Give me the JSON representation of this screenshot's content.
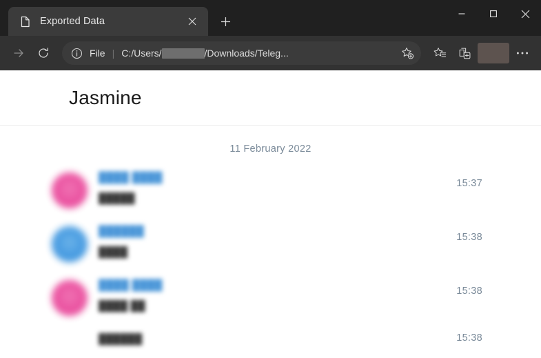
{
  "window": {
    "controls": {
      "minimize_label": "Minimize",
      "maximize_label": "Maximize",
      "close_label": "Close"
    }
  },
  "tabstrip": {
    "tabs": [
      {
        "title": "Exported Data",
        "favicon": "document-icon",
        "close_label": "Close tab",
        "active": true
      }
    ],
    "new_tab_label": "New tab"
  },
  "toolbar": {
    "back_label": "Back",
    "forward_label": "Forward",
    "refresh_label": "Refresh",
    "address": {
      "info_icon": "info-icon",
      "scheme_label": "File",
      "separator": "|",
      "url_prefix": "C:/Users/",
      "url_redacted": "redacted-username",
      "url_suffix": "/Downloads/Teleg...",
      "full_url": "C:/Users/████/Downloads/Teleg...",
      "add_favorite_label": "Add this page to favorites"
    },
    "favorites_label": "Favorites",
    "collections_label": "Collections",
    "profile_label": "Profile",
    "settings_label": "Settings and more"
  },
  "page": {
    "title": "Jasmine",
    "date_divider": "11 February 2022",
    "colors": {
      "avatar_pink": "#ea4c9d",
      "avatar_blue": "#3f97e0",
      "sender_blue": "#4a96d8",
      "muted_gray": "#7a8a99",
      "title_dark": "#1a1a1a"
    },
    "messages": [
      {
        "avatar_color": "pink",
        "avatar": true,
        "sender": "████ ████",
        "text": "█████",
        "time": "15:37",
        "continuation": false
      },
      {
        "avatar_color": "blue",
        "avatar": true,
        "sender": "██████",
        "text": "████",
        "time": "15:38",
        "continuation": false
      },
      {
        "avatar_color": "pink",
        "avatar": true,
        "sender": "████ ████",
        "text": "████ ██",
        "time": "15:38",
        "continuation": false
      },
      {
        "avatar_color": "",
        "avatar": false,
        "sender": "",
        "text": "██████",
        "time": "15:38",
        "continuation": true
      }
    ]
  }
}
